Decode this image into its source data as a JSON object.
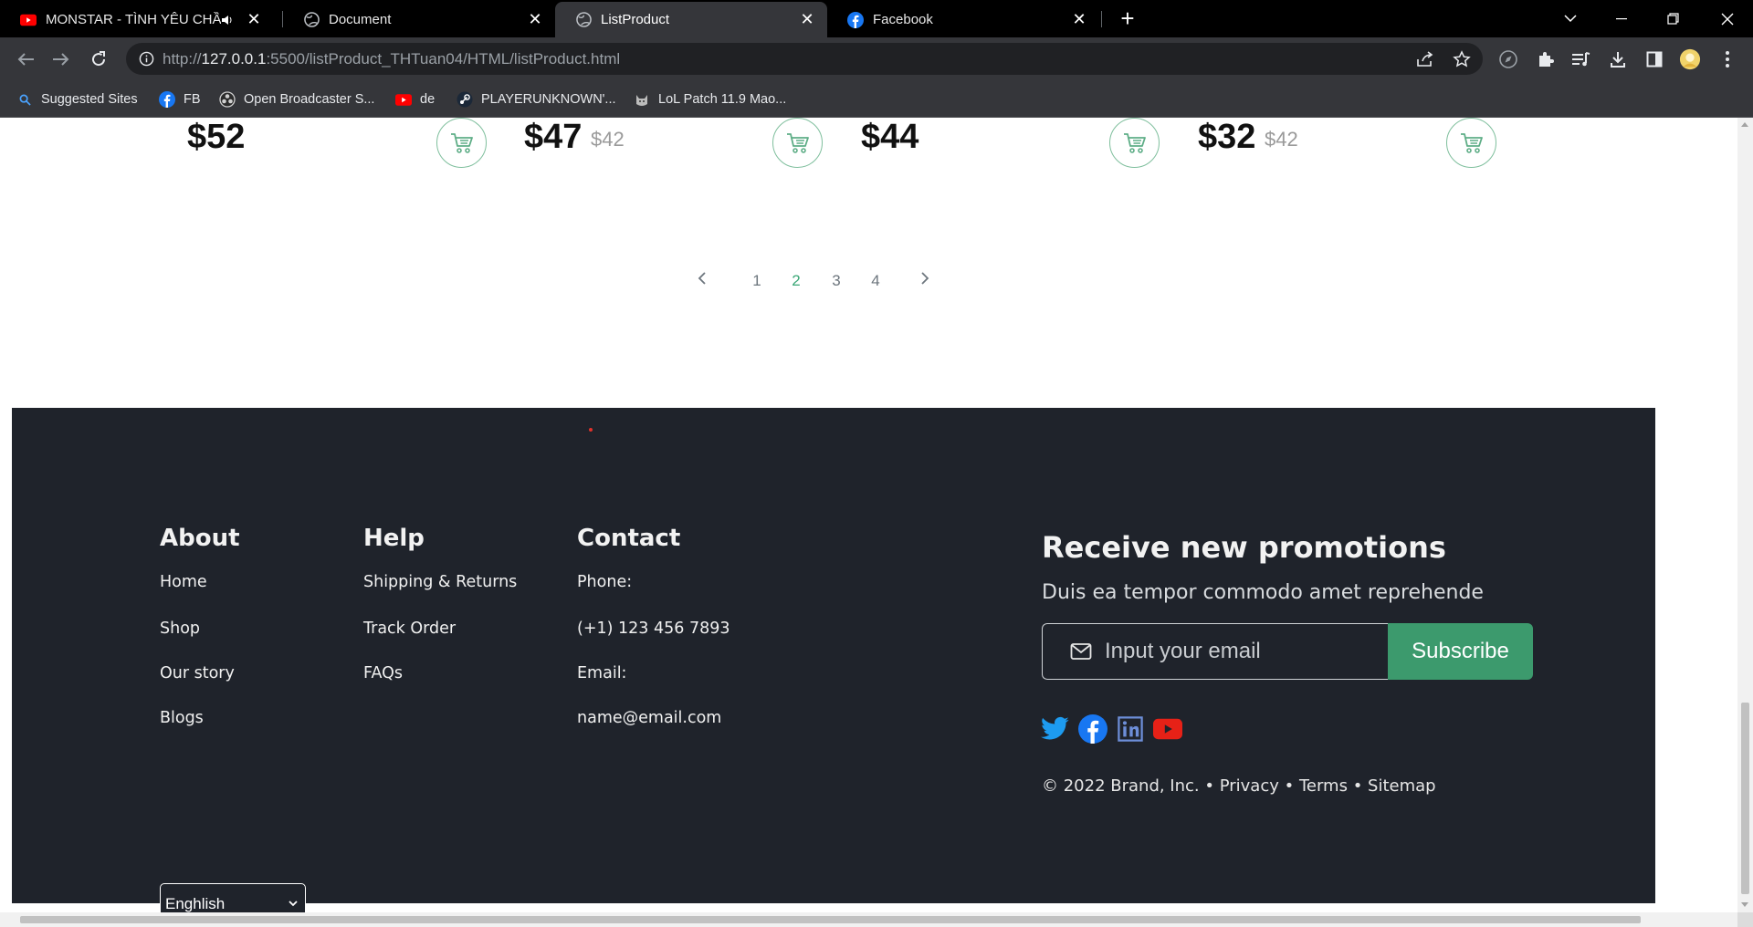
{
  "browser": {
    "tabs": [
      {
        "title": "MONSTAR - TÌNH YÊU CHẦM CHẬM",
        "favicon": "youtube-icon",
        "audio": true
      },
      {
        "title": "Document",
        "favicon": "globe-icon"
      },
      {
        "title": "ListProduct",
        "favicon": "globe-icon",
        "active": true
      },
      {
        "title": "Facebook",
        "favicon": "facebook-icon"
      }
    ],
    "url_prefix": "http://",
    "url_host": "127.0.0.1",
    "url_rest": ":5500/listProduct_THTuan04/HTML/listProduct.html",
    "bookmarks": [
      {
        "label": "Suggested Sites",
        "icon": "search-icon"
      },
      {
        "label": "FB",
        "icon": "facebook-icon"
      },
      {
        "label": "Open Broadcaster S...",
        "icon": "obs-icon"
      },
      {
        "label": "de",
        "icon": "youtube-icon"
      },
      {
        "label": "PLAYERUNKNOWN'...",
        "icon": "steam-icon"
      },
      {
        "label": "LoL Patch 11.9 Mao...",
        "icon": "cat-icon"
      }
    ]
  },
  "products": [
    {
      "price": "$52",
      "old_price": ""
    },
    {
      "price": "$47",
      "old_price": "$42"
    },
    {
      "price": "$44",
      "old_price": ""
    },
    {
      "price": "$32",
      "old_price": "$42"
    }
  ],
  "pagination": {
    "pages": [
      "1",
      "2",
      "3",
      "4"
    ],
    "current": "2"
  },
  "footer": {
    "about": {
      "heading": "About",
      "links": [
        "Home",
        "Shop",
        "Our story",
        "Blogs"
      ]
    },
    "help": {
      "heading": "Help",
      "links": [
        "Shipping & Returns",
        "Track Order",
        "FAQs"
      ]
    },
    "contact": {
      "heading": "Contact",
      "lines": [
        "Phone:",
        "(+1) 123 456 7893",
        "Email:",
        "name@email.com"
      ]
    },
    "language": "Enghlish",
    "promo": {
      "heading": "Receive new promotions",
      "subtext": "Duis ea tempor commodo amet reprehende",
      "email_placeholder": "Input your email",
      "subscribe_label": "Subscribe"
    },
    "social": [
      "twitter-icon",
      "facebook-icon",
      "linkedin-icon",
      "youtube-icon"
    ],
    "copyright": "© 2022 Brand, Inc.",
    "legal_links": [
      "Privacy",
      "Terms",
      "Sitemap"
    ]
  },
  "colors": {
    "accent": "#3c9a6d",
    "footer_bg": "#1f232b",
    "pager_active": "#3aa776"
  }
}
